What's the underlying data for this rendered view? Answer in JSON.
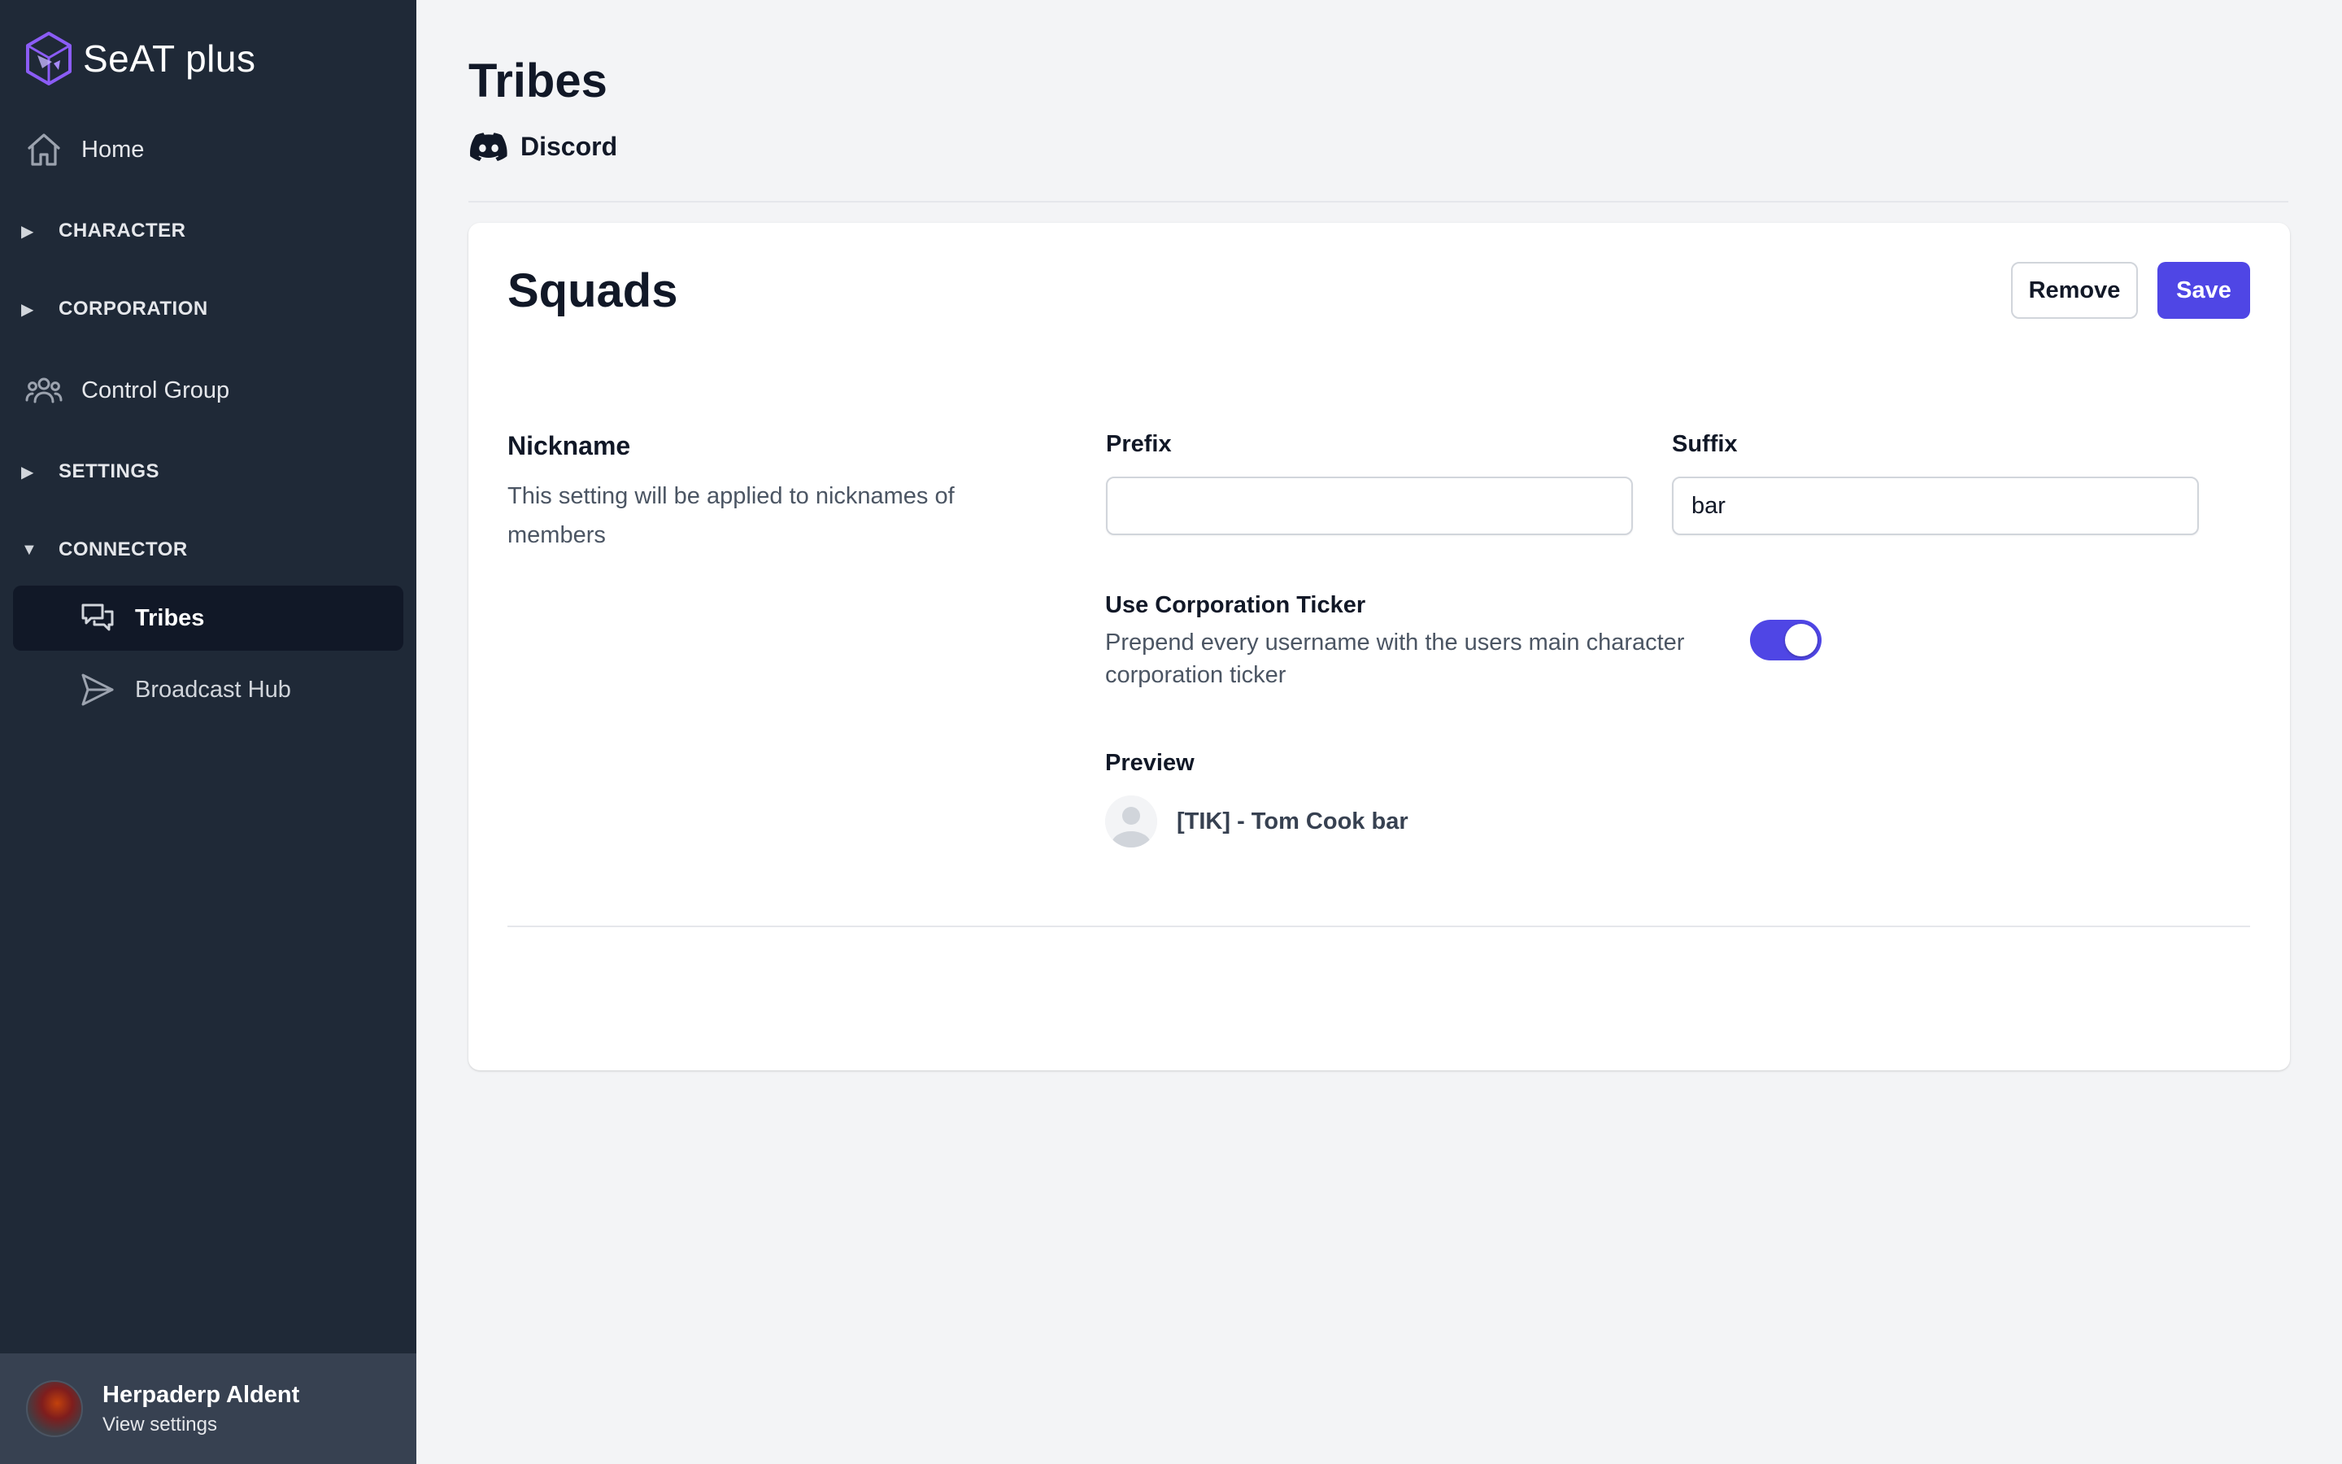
{
  "app": {
    "name": "SeAT plus"
  },
  "sidebar": {
    "home": {
      "label": "Home",
      "icon": "home-icon"
    },
    "sections": [
      {
        "label": "CHARACTER",
        "expanded": false
      },
      {
        "label": "CORPORATION",
        "expanded": false
      },
      {
        "label": "SETTINGS",
        "expanded": false
      },
      {
        "label": "CONNECTOR",
        "expanded": true
      }
    ],
    "control_group": {
      "label": "Control Group",
      "icon": "user-group-icon"
    },
    "connector_items": [
      {
        "label": "Tribes",
        "icon": "chat-bubbles-icon",
        "active": true
      },
      {
        "label": "Broadcast Hub",
        "icon": "paper-plane-icon",
        "active": false
      }
    ],
    "user": {
      "name": "Herpaderp Aldent",
      "sub": "View settings"
    }
  },
  "page": {
    "title": "Tribes",
    "subtitle": "Discord"
  },
  "card": {
    "title": "Squads",
    "remove_label": "Remove",
    "save_label": "Save",
    "nickname": {
      "title": "Nickname",
      "description": "This setting will be applied to nicknames of members",
      "prefix_label": "Prefix",
      "prefix_value": "",
      "suffix_label": "Suffix",
      "suffix_value": "bar"
    },
    "ticker": {
      "title": "Use Corporation Ticker",
      "description": "Prepend every username with the users main character corporation ticker",
      "enabled": true
    },
    "preview": {
      "label": "Preview",
      "name": "[TIK] - Tom Cook bar"
    }
  },
  "colors": {
    "sidebar_bg": "#1f2937",
    "sidebar_active_bg": "#111827",
    "user_panel_bg": "#374151",
    "accent": "#4f46e5",
    "page_bg": "#f3f4f6"
  }
}
